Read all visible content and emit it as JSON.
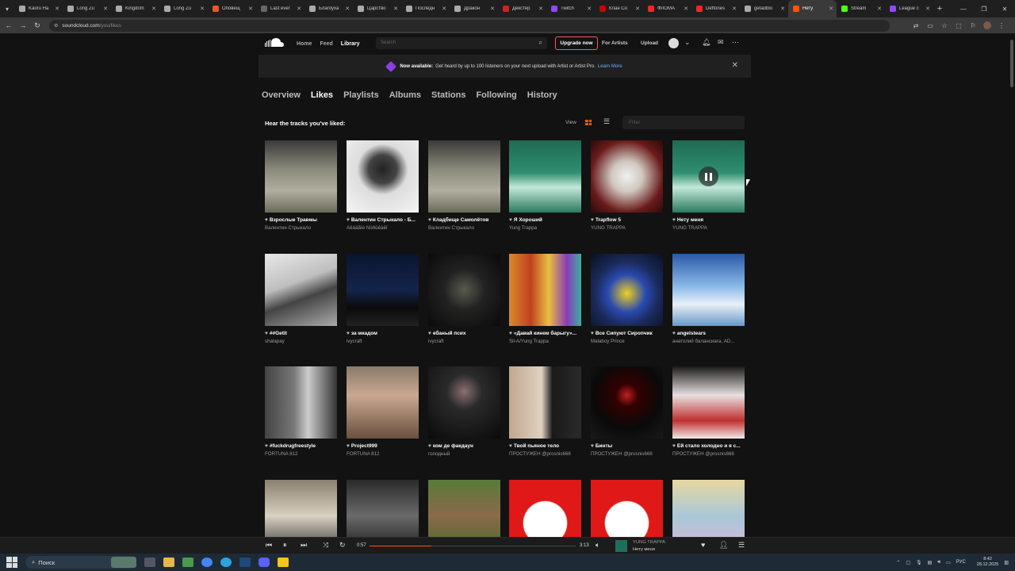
{
  "browser": {
    "tabs": [
      {
        "title": "Kaoru Ha",
        "color": "#aaa"
      },
      {
        "title": "Long Zu",
        "color": "#aaa"
      },
      {
        "title": "Kingdom",
        "color": "#aaa"
      },
      {
        "title": "Long Zu",
        "color": "#aaa"
      },
      {
        "title": "Оповещ",
        "color": "#e8562a"
      },
      {
        "title": "Last ever",
        "color": "#666"
      },
      {
        "title": "Благоуха",
        "color": "#aaa"
      },
      {
        "title": "Царство",
        "color": "#aaa"
      },
      {
        "title": "Последн",
        "color": "#aaa"
      },
      {
        "title": "Дракон",
        "color": "#aaa"
      },
      {
        "title": "Декстер",
        "color": "#c22"
      },
      {
        "title": "Twitch",
        "color": "#9146ff"
      },
      {
        "title": "Клан Со",
        "color": "#c00"
      },
      {
        "title": "ФЛОМА",
        "color": "#f22"
      },
      {
        "title": "Deftones",
        "color": "#f22"
      },
      {
        "title": "getadblo",
        "color": "#aaa"
      },
      {
        "title": "Нету",
        "color": "#f50",
        "active": true
      },
      {
        "title": "Stream",
        "color": "#53fc18"
      },
      {
        "title": "League c",
        "color": "#9146ff"
      }
    ],
    "url_host": "soundcloud.com",
    "url_path": "/you/likes"
  },
  "header": {
    "nav": [
      "Home",
      "Feed",
      "Library"
    ],
    "active_nav": "Library",
    "search_placeholder": "Search",
    "upgrade_label": "Upgrade now",
    "for_artists": "For Artists",
    "upload": "Upload"
  },
  "banner": {
    "bold": "Now available:",
    "text": "Get heard by up to 100 listeners on your next upload with Artist or Artist Pro.",
    "link": "Learn More"
  },
  "library_tabs": [
    "Overview",
    "Likes",
    "Playlists",
    "Albums",
    "Stations",
    "Following",
    "History"
  ],
  "active_tab": "Likes",
  "subheading": "Hear the tracks you've liked:",
  "view_label": "View",
  "filter_placeholder": "Filter",
  "tracks": [
    {
      "title": "Взрослые Травмы",
      "artist": "Валентин Стрыкало",
      "art": "valentin"
    },
    {
      "title": "Валентин Стрыкало - Б...",
      "artist": "Ãêàäåìè Ñòðûêàëî",
      "art": "bw-man"
    },
    {
      "title": "Кладбище Самолётов",
      "artist": "Валентин Стрыкало",
      "art": "valentin"
    },
    {
      "title": "Я Хороший",
      "artist": "Yung Trappa",
      "art": "pinkman"
    },
    {
      "title": "Trapflow 5",
      "artist": "YUNG TRAPPA",
      "art": "trapflow"
    },
    {
      "title": "Нету меня",
      "artist": "YUNG TRAPPA",
      "art": "pinkman",
      "playing": true
    },
    {
      "title": "##Getit",
      "artist": "shalapay",
      "art": "room"
    },
    {
      "title": "за мкадом",
      "artist": "ivycraft",
      "art": "night"
    },
    {
      "title": "ебаный псих",
      "artist": "ivycraft",
      "art": "dark"
    },
    {
      "title": "«Давай кинем барыгу»...",
      "artist": "Sil-A/Yung Trappa",
      "art": "collage"
    },
    {
      "title": "Все Сипуют Сиропчик",
      "artist": "Malaboy Prince",
      "art": "minion"
    },
    {
      "title": "angelstears",
      "artist": "анатолий балансиага, AD...",
      "art": "angel"
    },
    {
      "title": "#fuckdrugfreestyle",
      "artist": "FORTUNA 812",
      "art": "hooded"
    },
    {
      "title": "Project999",
      "artist": "FORTUNA 812",
      "art": "selfie"
    },
    {
      "title": "ком де факдаун",
      "artist": "голодный",
      "art": "blackgirl"
    },
    {
      "title": "Твой пьяное тело",
      "artist": "ПРОСТУЖЕН @prosnis666",
      "art": "body"
    },
    {
      "title": "Бинты",
      "artist": "ПРОСТУЖЕН @prosnis666",
      "art": "anime"
    },
    {
      "title": "Ей стало холодно и я с...",
      "artist": "ПРОСТУЖЕН @prosnis666",
      "art": "l-anime"
    },
    {
      "title": "",
      "artist": "",
      "art": "cover-face"
    },
    {
      "title": "",
      "artist": "",
      "art": "group"
    },
    {
      "title": "",
      "artist": "",
      "art": "grass"
    },
    {
      "title": "",
      "artist": "",
      "art": "redface"
    },
    {
      "title": "",
      "artist": "",
      "art": "redface"
    },
    {
      "title": "",
      "artist": "",
      "art": "oratory"
    }
  ],
  "player": {
    "elapsed": "0:57",
    "duration": "3:13",
    "artist": "YUNG TRAPPA",
    "title": "Нету меня",
    "progress": 0.3
  },
  "taskbar": {
    "search_label": "Поиск",
    "lang": "РУС",
    "time": "8:42",
    "date": "28.12.2025"
  }
}
